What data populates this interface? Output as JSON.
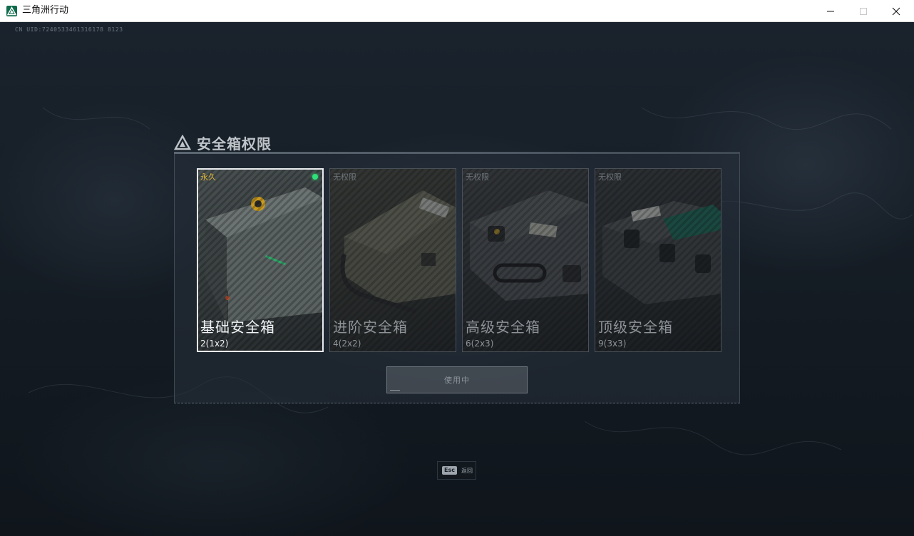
{
  "window": {
    "title": "三角洲行动",
    "icons": {
      "app": "delta-logo-icon",
      "minimize": "minimize-icon",
      "maximize": "maximize-icon",
      "close": "close-icon"
    }
  },
  "uid_label": "CN UID:7240533461316178 8123",
  "dialog": {
    "title": "安全箱权限",
    "title_icon": "warning-triangle-icon",
    "cards": [
      {
        "tag": "永久",
        "name": "基础安全箱",
        "capacity": "2(1x2)",
        "selected": true,
        "active_indicator": "green-dot-icon"
      },
      {
        "tag": "无权限",
        "name": "进阶安全箱",
        "capacity": "4(2x2)",
        "selected": false
      },
      {
        "tag": "无权限",
        "name": "高级安全箱",
        "capacity": "6(2x3)",
        "selected": false
      },
      {
        "tag": "无权限",
        "name": "顶级安全箱",
        "capacity": "9(3x3)",
        "selected": false
      }
    ],
    "action_button": "使用中"
  },
  "esc": {
    "key": "Esc",
    "label": "返回"
  },
  "colors": {
    "background": "#141b23",
    "accent_green": "#2fe07a",
    "tag_gold": "#d9b43a",
    "selected_border": "#e9ecef"
  }
}
